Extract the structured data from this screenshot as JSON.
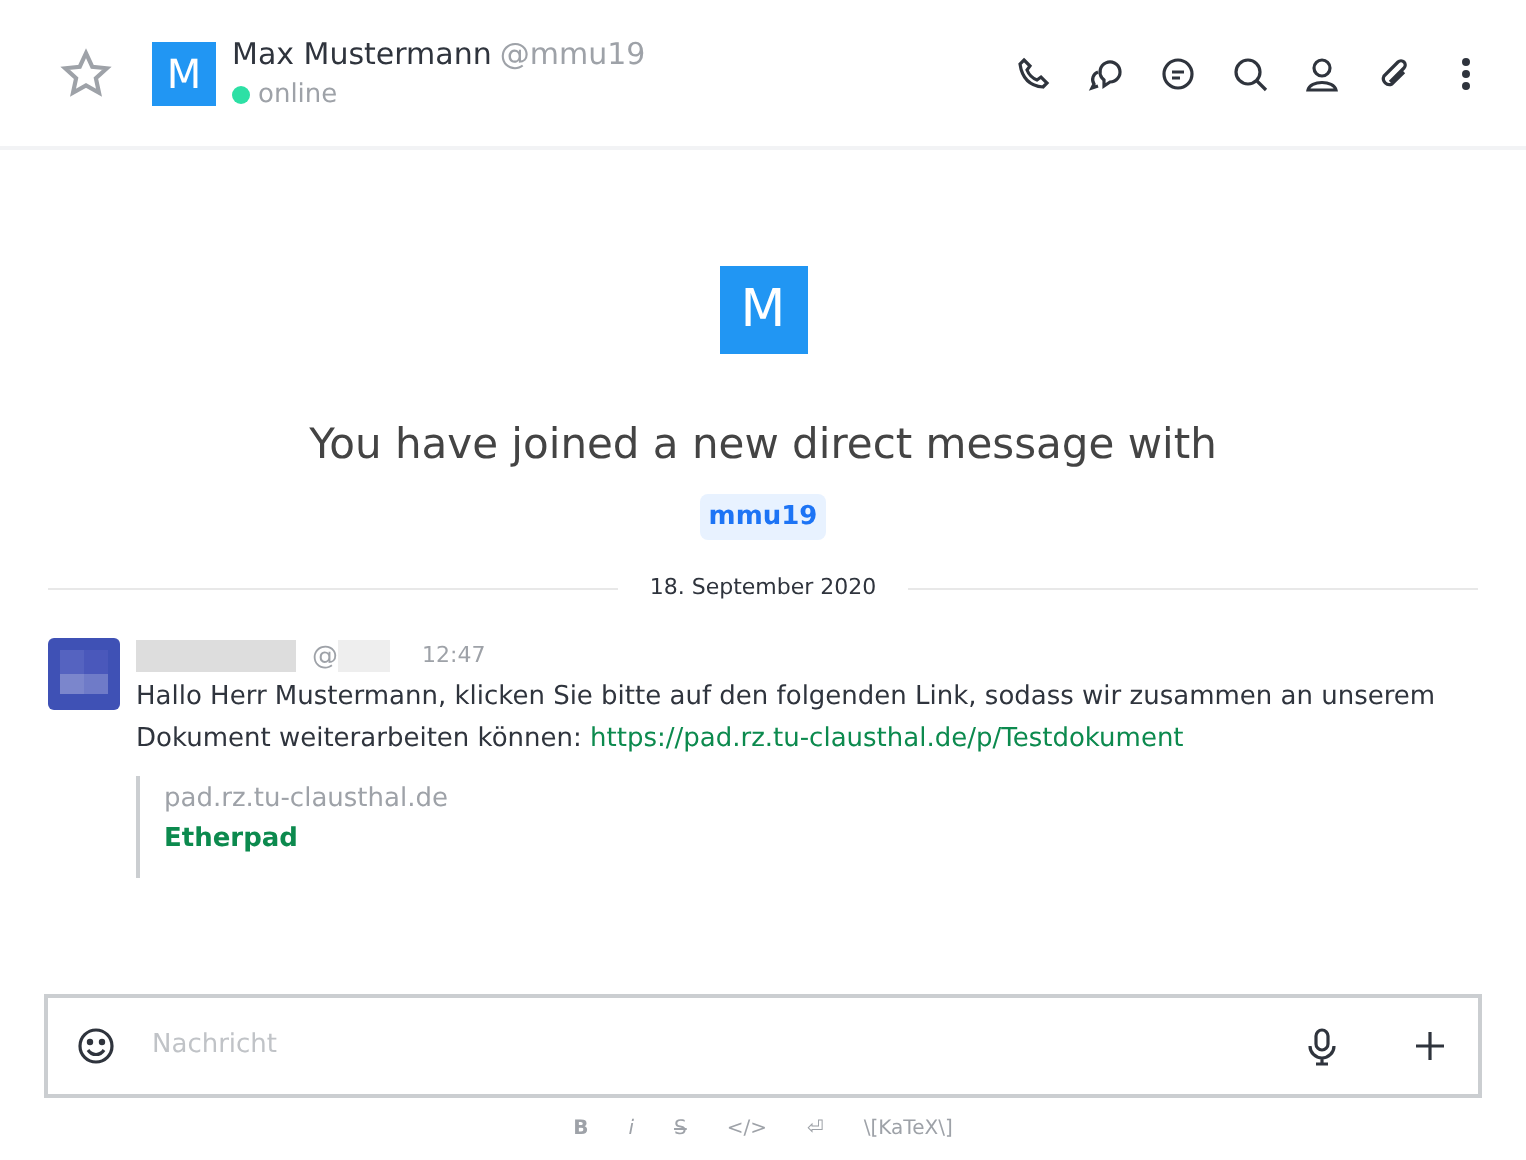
{
  "header": {
    "favorite": false,
    "avatar_letter": "M",
    "name": "Max Mustermann",
    "username": "@mmu19",
    "status": "online",
    "color": "#2de0a5"
  },
  "intro": {
    "avatar_letter": "M",
    "text": "You have joined a new direct message with",
    "mention": "mmu19"
  },
  "date_divider": "18. September 2020",
  "messages": [
    {
      "at": "@",
      "time": "12:47",
      "text": "Hallo Herr Mustermann, klicken Sie bitte auf den folgenden Link, sodass wir zusammen an unserem Dokument weiterarbeiten können: ",
      "link": "https://pad.rz.tu-clausthal.de/p/Testdokument",
      "preview": {
        "host": "pad.rz.tu-clausthal.de",
        "title": "Etherpad"
      }
    }
  ],
  "composer": {
    "placeholder": "Nachricht"
  },
  "format_bar": [
    {
      "kind": "bold",
      "label": "B"
    },
    {
      "kind": "italic",
      "label": "i"
    },
    {
      "kind": "strike",
      "label": "S"
    },
    {
      "kind": "code",
      "label": "</>"
    },
    {
      "kind": "newline",
      "label": "⏎"
    },
    {
      "kind": "katex",
      "label": "\\[KaTeX\\]"
    }
  ]
}
